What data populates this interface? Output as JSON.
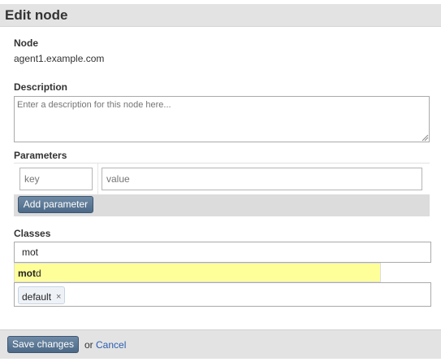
{
  "page": {
    "title": "Edit node"
  },
  "node": {
    "label": "Node",
    "value": "agent1.example.com"
  },
  "description": {
    "label": "Description",
    "placeholder": "Enter a description for this node here..."
  },
  "parameters": {
    "label": "Parameters",
    "key_placeholder": "key",
    "value_placeholder": "value",
    "add_button": "Add parameter"
  },
  "classes": {
    "label": "Classes",
    "input_value": "mot",
    "suggestion_match": "mot",
    "suggestion_rest": "d",
    "tags": [
      "default"
    ],
    "tag_remove_glyph": "×"
  },
  "footer": {
    "save_label": "Save changes",
    "or_text": "or",
    "cancel_label": "Cancel"
  },
  "colors": {
    "button_bg": "#5a7796",
    "link": "#2a5db0",
    "suggestion_highlight": "#ffff99",
    "bar_bg": "#e3e3e3"
  }
}
